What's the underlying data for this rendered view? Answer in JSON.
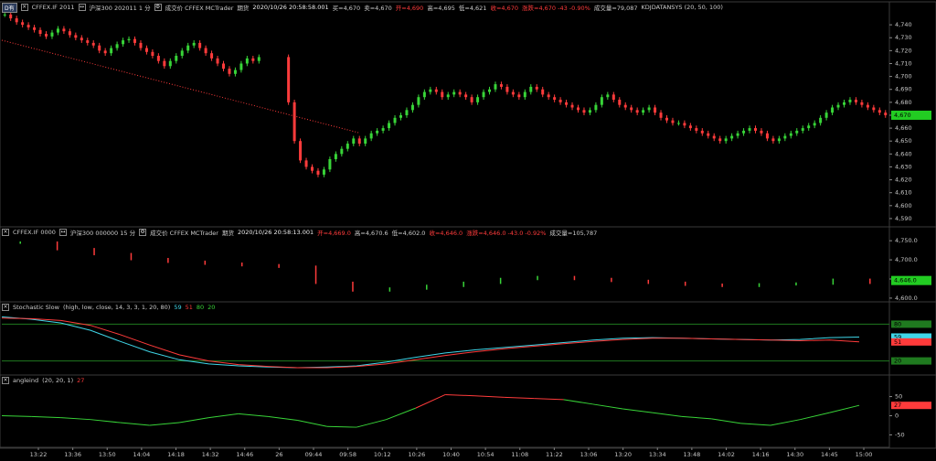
{
  "pane1_header": {
    "tab": "D有",
    "symbol": "CFFEX.IF 2011",
    "descr": "沪深300 202011 1 分",
    "exchange": "成交价 CFFEX MCTrader",
    "mode": "期货",
    "datetime": "2020/10/26 20:58:58.001",
    "buy": "买=4,670",
    "sell": "卖=4,670",
    "open": "开=4,690",
    "high": "高=4,695",
    "low": "低=4,621",
    "close": "收=4,670",
    "change": "涨跌=4,670 -43 -0.90%",
    "volume": "成交量=79,087",
    "study": "KDJDATANSYS (20, 50, 100)"
  },
  "pane1_axis": {
    "ticks": [
      "4,740",
      "4,730",
      "4,720",
      "4,710",
      "4,700",
      "4,690",
      "4,680",
      "4,670",
      "4,660",
      "4,650",
      "4,640",
      "4,630",
      "4,620",
      "4,610",
      "4,600",
      "4,590"
    ],
    "last": "4,670"
  },
  "pane2_header": {
    "symbol": "CFFEX.IF 0000",
    "descr": "沪深300 000000 15 分",
    "exchange": "成交价 CFFEX MCTrader",
    "mode": "期货",
    "datetime": "2020/10/26 20:58:13.001",
    "open": "开=4,669.0",
    "high": "高=4,670.6",
    "low": "低=4,602.0",
    "close": "收=4,646.0",
    "change": "涨跌=4,646.0 -43.0 -0.92%",
    "volume": "成交量=105,787"
  },
  "pane2_axis": {
    "ticks": [
      "4,750.0",
      "4,700.0",
      "4,650.0",
      "4,600.0"
    ],
    "last": "4,646.0"
  },
  "pane3_header": {
    "name": "Stochastic Slow",
    "params": "(high, low, close, 14, 3, 3, 1, 20, 80)",
    "v1": "59",
    "v2": "51",
    "v3": "80",
    "v4": "20"
  },
  "pane3_axis": {
    "hi": "80",
    "k": "59",
    "d": "51",
    "lo": "20"
  },
  "pane4_header": {
    "name": "angleind",
    "params": "(20, 20, 1)",
    "v1": "27"
  },
  "pane4_axis": {
    "ticks": [
      "50",
      "27",
      "0",
      "-50"
    ],
    "last": "27"
  },
  "time_axis": [
    "13:22",
    "13:36",
    "13:50",
    "14:04",
    "14:18",
    "14:32",
    "14:46",
    "26",
    "09:44",
    "09:58",
    "10:12",
    "10:26",
    "10:40",
    "10:54",
    "11:08",
    "11:22",
    "13:06",
    "13:20",
    "13:34",
    "13:48",
    "14:02",
    "14:16",
    "14:30",
    "14:45",
    "15:00"
  ],
  "colors": {
    "up": "#38d438",
    "down": "#ff3b3b",
    "k": "#3fd6e8",
    "d": "#ff3b3b",
    "grid": "#0d3a0d",
    "axis": "#c8c8c8"
  },
  "chart_data": [
    {
      "type": "candlestick",
      "title": "CFFEX.IF 2011 1分",
      "y_range": [
        4585,
        4750
      ],
      "close": [
        4748,
        4745,
        4742,
        4740,
        4738,
        4736,
        4733,
        4731,
        4734,
        4737,
        4735,
        4732,
        4730,
        4728,
        4726,
        4724,
        4720,
        4718,
        4722,
        4725,
        4728,
        4729,
        4726,
        4722,
        4719,
        4716,
        4712,
        4708,
        4712,
        4716,
        4720,
        4724,
        4726,
        4722,
        4718,
        4714,
        4710,
        4706,
        4702,
        4705,
        4710,
        4714,
        4712,
        4715,
        null,
        null,
        null,
        null,
        4680,
        4650,
        4635,
        4630,
        4627,
        4624,
        4628,
        4636,
        4640,
        4644,
        4648,
        4652,
        4648,
        4652,
        4656,
        4658,
        4660,
        4664,
        4668,
        4670,
        4674,
        4678,
        4684,
        4688,
        4690,
        4688,
        4684,
        4686,
        4688,
        4686,
        4684,
        4680,
        4684,
        4688,
        4690,
        4694,
        4692,
        4688,
        4686,
        4684,
        4688,
        4692,
        4690,
        4686,
        4684,
        4682,
        4680,
        4678,
        4676,
        4674,
        4672,
        4674,
        4678,
        4684,
        4686,
        4682,
        4678,
        4676,
        4674,
        4672,
        4674,
        4676,
        4672,
        4668,
        4666,
        4664,
        4664,
        4662,
        4660,
        4658,
        4656,
        4654,
        4652,
        4650,
        4652,
        4654,
        4656,
        4658,
        4660,
        4658,
        4656,
        4652,
        4650,
        4652,
        4654,
        4656,
        4658,
        4660,
        4662,
        4664,
        4668,
        4672,
        4676,
        4678,
        4680,
        4682,
        4680,
        4678,
        4676,
        4674,
        4672,
        4670
      ]
    },
    {
      "type": "candlestick",
      "title": "CFFEX.IF 0000 15分",
      "y_range": [
        4595,
        4760
      ],
      "close": [
        4745,
        4728,
        4715,
        4702,
        4695,
        4690,
        4686,
        4682,
        4640,
        4620,
        4625,
        4632,
        4640,
        4650,
        4655,
        4650,
        4645,
        4640,
        4635,
        4632,
        4636,
        4638,
        4648,
        4640
      ]
    },
    {
      "type": "line",
      "title": "Stochastic Slow",
      "y_range": [
        0,
        100
      ],
      "series": [
        {
          "name": "K",
          "values": [
            92,
            88,
            82,
            70,
            52,
            35,
            22,
            15,
            12,
            10,
            9,
            10,
            12,
            18,
            26,
            33,
            38,
            42,
            46,
            50,
            54,
            57,
            58,
            57,
            56,
            55,
            54,
            55,
            58,
            59
          ]
        },
        {
          "name": "D",
          "values": [
            90,
            89,
            86,
            78,
            63,
            46,
            30,
            20,
            14,
            11,
            9,
            9,
            11,
            15,
            22,
            29,
            35,
            40,
            44,
            48,
            52,
            55,
            57,
            57,
            56,
            55,
            54,
            53,
            54,
            51
          ]
        }
      ]
    },
    {
      "type": "line",
      "title": "angleind",
      "y_range": [
        -80,
        80
      ],
      "values": [
        0,
        -2,
        -5,
        -10,
        -18,
        -25,
        -18,
        -5,
        5,
        -2,
        -12,
        -28,
        -30,
        -10,
        20,
        55,
        52,
        48,
        45,
        42,
        30,
        18,
        8,
        -2,
        -8,
        -20,
        -25,
        -10,
        8,
        27
      ]
    }
  ]
}
